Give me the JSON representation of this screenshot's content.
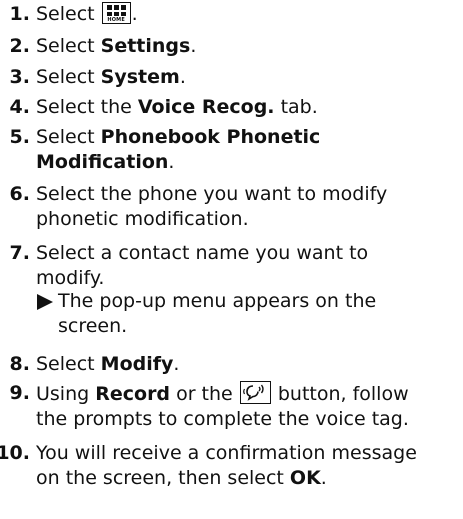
{
  "steps": [
    {
      "num": "1.",
      "text": "Select",
      "icon": "home-icon",
      "icon_label": "HOME",
      "after": "."
    },
    {
      "num": "2.",
      "prefix": "Select ",
      "bold": "Settings",
      "suffix": "."
    },
    {
      "num": "3.",
      "prefix": "Select ",
      "bold": "System",
      "suffix": "."
    },
    {
      "num": "4.",
      "prefix": "Select the ",
      "bold": "Voice Recog.",
      "suffix": " tab."
    },
    {
      "num": "5.",
      "prefix": "Select ",
      "bold_line1": "Phonebook Phonetic",
      "bold_line2": "Modification",
      "suffix": "."
    },
    {
      "num": "6.",
      "line1": "Select the phone you want to modify",
      "line2": "phonetic modification."
    },
    {
      "num": "7.",
      "line1": "Select a contact name you want to",
      "line2": "modify.",
      "sub_line1": "The pop-up menu appears on the",
      "sub_line2": "screen."
    },
    {
      "num": "8.",
      "prefix": "Select ",
      "bold": "Modify",
      "suffix": "."
    },
    {
      "num": "9.",
      "prefix": "Using ",
      "bold": "Record",
      "middle": " or the ",
      "icon": "talk-icon",
      "after_icon": " button, follow",
      "line2": "the prompts to complete the voice tag."
    },
    {
      "num": "10.",
      "line1": "You will receive a confirmation message",
      "line2_prefix": "on the screen, then select ",
      "line2_bold": "OK",
      "line2_suffix": "."
    }
  ]
}
